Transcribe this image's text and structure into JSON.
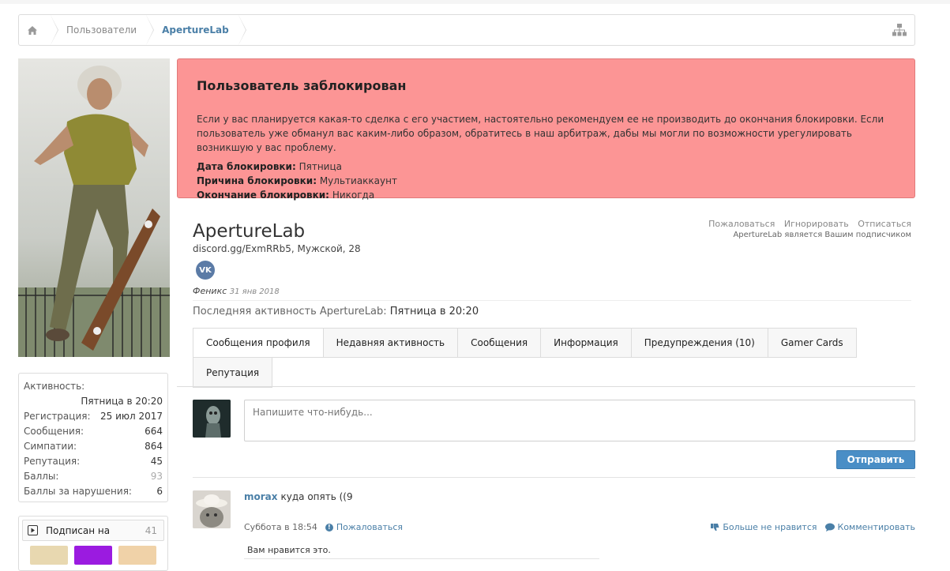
{
  "breadcrumb": {
    "home_icon": "home-icon",
    "items": [
      "Пользователи",
      "ApertureLab"
    ],
    "sitemap_icon": "sitemap-icon"
  },
  "sidebar": {
    "stats": {
      "activity_label": "Активность:",
      "activity_value": "Пятница в 20:20",
      "registration_label": "Регистрация:",
      "registration_value": "25 июл 2017",
      "messages_label": "Сообщения:",
      "messages_value": "664",
      "likes_label": "Симпатии:",
      "likes_value": "864",
      "reputation_label": "Репутация:",
      "reputation_value": "45",
      "points_label": "Баллы:",
      "points_value": "93",
      "violations_label": "Баллы за нарушения:",
      "violations_value": "6"
    },
    "following": {
      "label": "Подписан на",
      "count": "41"
    }
  },
  "ban": {
    "title": "Пользователь заблокирован",
    "text": "Если у вас планируется какая-то сделка с его участием, настоятельно рекомендуем ее не производить до окончания блокировки. Если пользователь уже обманул вас каким-либо образом, обратитесь в наш арбитраж, дабы мы могли по возможности урегулировать возникшую у вас проблему.",
    "date_label": "Дата блокировки:",
    "date_value": "Пятница",
    "reason_label": "Причина блокировки:",
    "reason_value": "Мультиаккаунт",
    "end_label": "Окончание блокировки:",
    "end_value": "Никогда"
  },
  "profile": {
    "username": "ApertureLab",
    "subline": "discord.gg/ExmRRb5, Мужской, 28",
    "vk_label": "VK",
    "rank": "Феникс",
    "rank_date": "31 янв 2018",
    "actions": [
      "Пожаловаться",
      "Игнорировать",
      "Отписаться"
    ],
    "subscriber_note": "ApertureLab является Вашим подписчиком",
    "last_activity_prefix": "Последняя активность ApertureLab:",
    "last_activity_value": "Пятница в 20:20"
  },
  "tabs": [
    "Сообщения профиля",
    "Недавняя активность",
    "Сообщения",
    "Информация",
    "Предупреждения (10)",
    "Gamer Cards",
    "Репутация"
  ],
  "composer": {
    "placeholder": "Напишите что-нибудь...",
    "send_label": "Отправить"
  },
  "post": {
    "author": "morax",
    "text": "куда опять ((9",
    "time": "Суббота в 18:54",
    "report": "Пожаловаться",
    "unlike": "Больше не нравится",
    "comment": "Комментировать",
    "likes_text": "Вам нравится это."
  },
  "colors": {
    "ban_bg": "#fc9595",
    "link": "#4a7fa7",
    "button": "#4a8ec6"
  }
}
